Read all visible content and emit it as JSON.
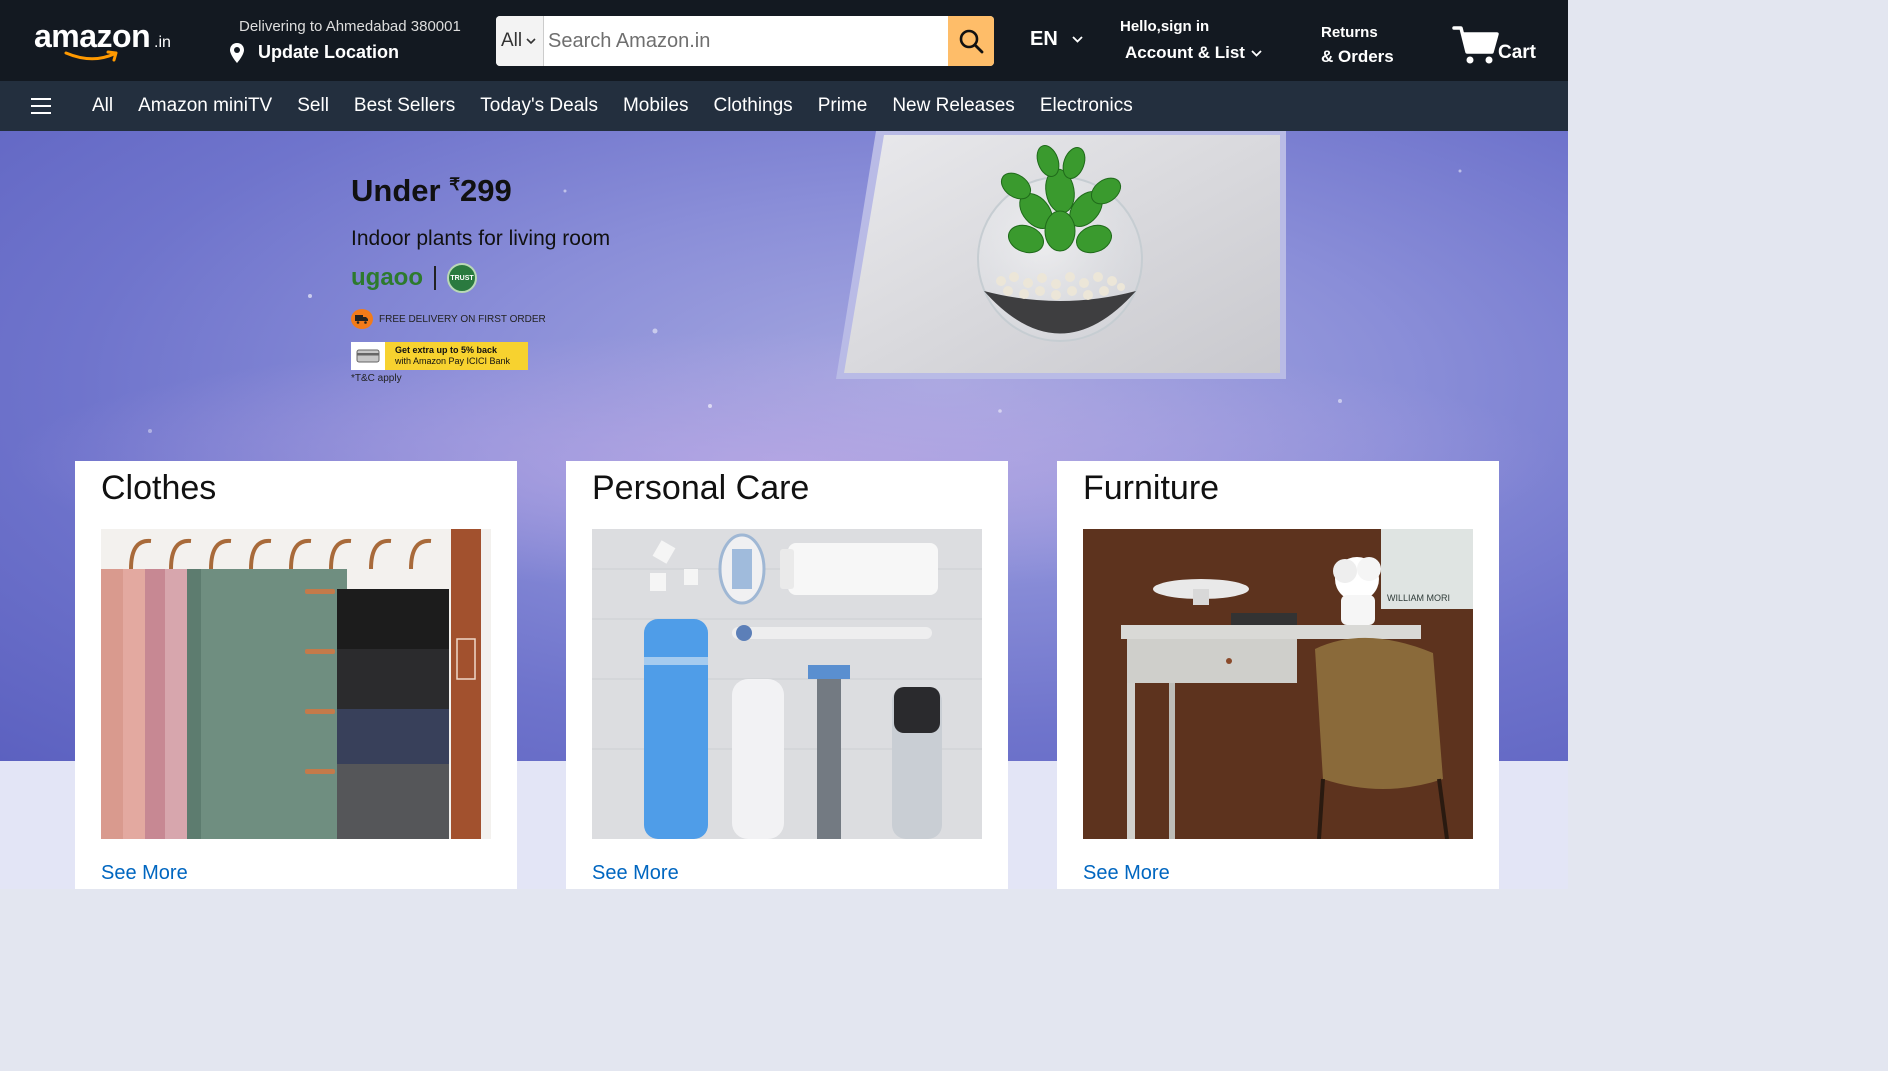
{
  "header": {
    "logo_text": "amazon",
    "logo_tld": ".in",
    "deliver_line1": "Delivering to Ahmedabad 380001",
    "deliver_line2": "Update Location",
    "search_category": "All",
    "search_placeholder": "Search Amazon.in",
    "language": "EN",
    "account_line1": "Hello,sign in",
    "account_line2": "Account & List",
    "returns_line1": "Returns",
    "returns_line2": "& Orders",
    "cart_label": "Cart"
  },
  "nav": {
    "items": [
      "All",
      "Amazon miniTV",
      "Sell",
      "Best Sellers",
      "Today's Deals",
      "Mobiles",
      "Clothings",
      "Prime",
      "New Releases",
      "Electronics"
    ]
  },
  "hero": {
    "title": "Under ",
    "currency": "₹",
    "price": "299",
    "subtitle": "Indoor plants for living room",
    "brand": "ugaoo",
    "badge": "TRUST",
    "free_delivery": "FREE DELIVERY ON FIRST ORDER",
    "cashback_line1": "Get extra up to 5% back",
    "cashback_line2": "with Amazon Pay ICICI Bank",
    "tc": "*T&C apply"
  },
  "cards": [
    {
      "title": "Clothes",
      "link": "See More"
    },
    {
      "title": "Personal Care",
      "link": "See More"
    },
    {
      "title": "Furniture",
      "link": "See More",
      "print_text": "WILLIAM MORI"
    }
  ],
  "colors": {
    "header_bg": "#131921",
    "nav_bg": "#232f3e",
    "search_button": "#febd69",
    "link": "#0066c0",
    "logo_smile": "#ff9900"
  }
}
